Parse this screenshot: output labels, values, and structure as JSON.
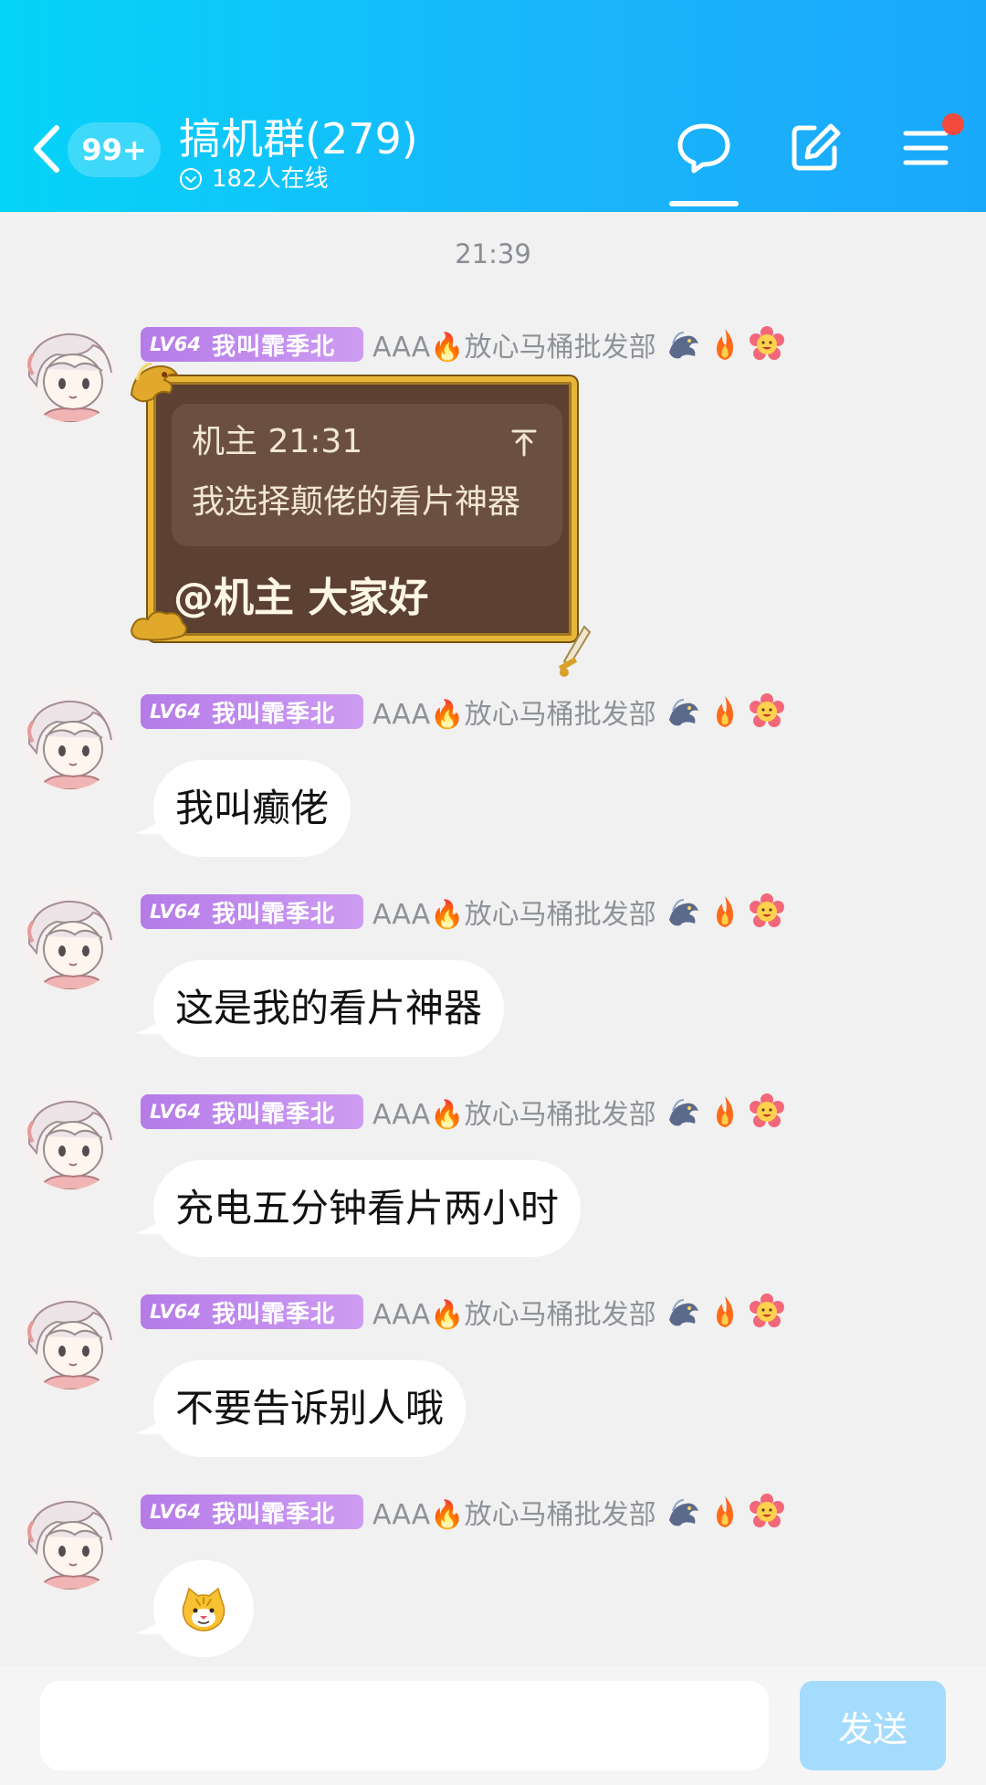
{
  "header": {
    "unread_count": "99+",
    "group_name": "搞机群(279)",
    "online_text": "182人在线",
    "icons": [
      "back-icon",
      "chat-bubble-icon",
      "edit-icon",
      "menu-icon"
    ],
    "colors": {
      "gradient_start": "#05d4f8",
      "gradient_end": "#1aa8fb",
      "notify_dot": "#f44a3e"
    }
  },
  "timestamp": "21:39",
  "sender": {
    "level": "LV64",
    "nickname": "我叫霏季北",
    "title_tag": "AAA🔥放心马桶批发部",
    "badge_icons": [
      "dragon-badge-icon",
      "fire-badge-icon",
      "flower-badge-icon"
    ]
  },
  "messages": [
    {
      "type": "reply_card",
      "quote_author": "机主 21:31",
      "quote_text": "我选择颠佬的看片神器",
      "text": "@机主 大家好"
    },
    {
      "type": "text",
      "text": "我叫癫佬"
    },
    {
      "type": "text",
      "text": "这是我的看片神器"
    },
    {
      "type": "text",
      "text": "充电五分钟看片两小时"
    },
    {
      "type": "text",
      "text": "不要告诉别人哦"
    },
    {
      "type": "sticker",
      "icon": "tiger-face-emoji-icon"
    }
  ],
  "input": {
    "value": "",
    "placeholder": "",
    "send_label": "发送"
  }
}
